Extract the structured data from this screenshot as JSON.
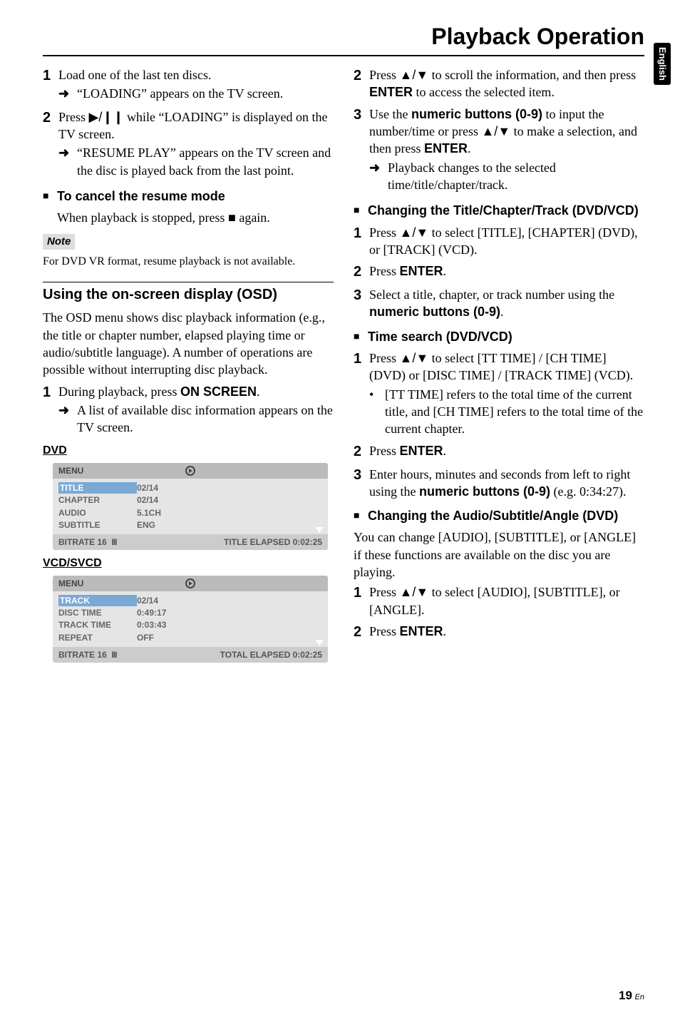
{
  "sideTab": "English",
  "pageTitle": "Playback Operation",
  "colL": {
    "step1": {
      "text": "Load one of the last ten discs.",
      "arrow1": "“LOADING” appears on the TV screen."
    },
    "step2": {
      "textA": "Press ",
      "glyph": "▶/❙❙",
      "textB": " while “LOADING” is displayed on the TV screen.",
      "arrow1": "“RESUME PLAY” appears on the TV screen and the disc is played back from the last point."
    },
    "h3cancel": "To cancel the resume mode",
    "cancelA": "When playback is stopped, press ",
    "cancelGlyph": "■",
    "cancelB": " again.",
    "noteLabel": "Note",
    "noteText": "For DVD VR format, resume playback is not available.",
    "osdTitle": "Using the on-screen display (OSD)",
    "osdPara": "The OSD menu shows disc playback information (e.g., the title or chapter number, elapsed playing time or audio/subtitle language). A number of operations are possible without interrupting disc playback.",
    "osdStep1": {
      "a": "During playback, press ",
      "bold": "ON SCREEN",
      "b": ".",
      "arrow1": "A list of available disc information appears on the TV screen."
    },
    "dvdLabel": "DVD",
    "vcdLabel": "VCD/SVCD",
    "menu1": {
      "top": "MENU",
      "rows": [
        {
          "k": "TITLE",
          "v": "02/14",
          "hl": true
        },
        {
          "k": "CHAPTER",
          "v": "02/14"
        },
        {
          "k": "AUDIO",
          "v": "5.1CH"
        },
        {
          "k": "SUBTITLE",
          "v": "ENG"
        }
      ],
      "botL": "BITRATE 16",
      "bars": "III",
      "botR": "TITLE ELAPSED 0:02:25"
    },
    "menu2": {
      "top": "MENU",
      "rows": [
        {
          "k": "TRACK",
          "v": "02/14",
          "hl": true
        },
        {
          "k": "DISC TIME",
          "v": "0:49:17"
        },
        {
          "k": "TRACK TIME",
          "v": "0:03:43"
        },
        {
          "k": "REPEAT",
          "v": "OFF"
        }
      ],
      "botL": "BITRATE 16",
      "bars": "III",
      "botR": "TOTAL ELAPSED 0:02:25"
    }
  },
  "colR": {
    "step2": {
      "a": "Press ",
      "glyph": "▲/▼",
      "b": " to scroll the information, and then press ",
      "bold": "ENTER",
      "c": " to access the selected item."
    },
    "step3": {
      "a": "Use the ",
      "bold1": "numeric buttons (0-9)",
      "b": " to input the number/time or press ",
      "glyph": "▲/▼",
      "c": " to make a selection, and then press ",
      "bold2": "ENTER",
      "d": ".",
      "arrow1": "Playback changes to the selected time/title/chapter/track."
    },
    "h3chg": "Changing the Title/Chapter/Track (DVD/VCD)",
    "cStep1": {
      "a": "Press ",
      "glyph": "▲/▼",
      "b": " to select [TITLE], [CHAPTER] (DVD), or [TRACK] (VCD)."
    },
    "cStep2": {
      "a": "Press ",
      "bold": "ENTER",
      "b": "."
    },
    "cStep3": {
      "a": "Select a title, chapter, or track number using the ",
      "bold": "numeric buttons (0-9)",
      "b": "."
    },
    "h3time": "Time search (DVD/VCD)",
    "tStep1": {
      "a": "Press ",
      "glyph": "▲/▼",
      "b": " to select [TT TIME] / [CH TIME] (DVD) or [DISC TIME] / [TRACK TIME] (VCD).",
      "bullet": "[TT TIME] refers to the total time of the current title, and [CH TIME] refers to the total time of the current chapter."
    },
    "tStep2": {
      "a": "Press ",
      "bold": "ENTER",
      "b": "."
    },
    "tStep3": {
      "a": "Enter hours, minutes and seconds from left to right using the ",
      "bold": "numeric buttons (0-9)",
      "b": " (e.g. 0:34:27)."
    },
    "h3audio": "Changing the Audio/Subtitle/Angle (DVD)",
    "audioPara": "You can change [AUDIO], [SUBTITLE], or [ANGLE] if these functions are available on the disc you are playing.",
    "aStep1": {
      "a": "Press ",
      "glyph": "▲/▼",
      "b": " to select [AUDIO], [SUBTITLE], or [ANGLE]."
    },
    "aStep2": {
      "a": "Press ",
      "bold": "ENTER",
      "b": "."
    }
  },
  "footer": {
    "page": "19",
    "suffix": "En"
  }
}
